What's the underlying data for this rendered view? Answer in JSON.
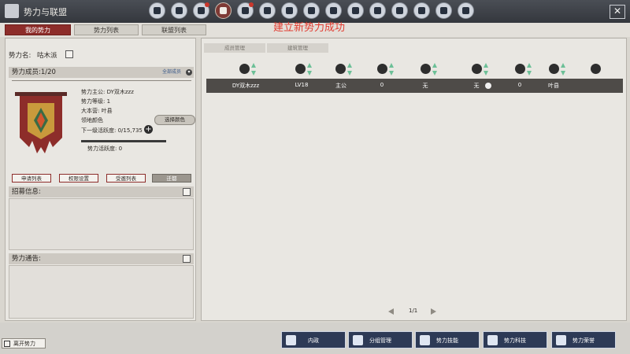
{
  "window": {
    "title": "势力与联盟",
    "close": "✕"
  },
  "top_icons": [
    "icon-1",
    "icon-2",
    "icon-3",
    "faction-icon",
    "icon-5",
    "icon-6",
    "icon-7",
    "icon-8",
    "icon-9",
    "icon-10",
    "icon-11",
    "icon-12",
    "icon-13",
    "icon-14",
    "icon-15"
  ],
  "tabs": {
    "my": "我的势力",
    "list": "势力列表",
    "alliance": "联盟列表"
  },
  "notice": "建立新势力成功",
  "left": {
    "faction_name_label": "势力名:",
    "faction_name": "咕木派",
    "members_label": "势力成员:1/20",
    "select_label": "全部成员",
    "info": {
      "lord": "势力主公: DY双木zzz",
      "level": "势力等级: 1",
      "base": "大本营: 叶县",
      "territory_color": "领地颜色",
      "next_activity": "下一级活跃度: 0/15,735",
      "activity": "势力活跃度: 0"
    },
    "choose_button": "选择颜色",
    "activity_progress": 0,
    "buttons": {
      "apply_list": "申请列表",
      "permissions": "权限设置",
      "invite_list": "受邀列表",
      "other": "迁都"
    },
    "recruit_label": "招募信息:",
    "announcement_label": "势力通告:"
  },
  "right": {
    "subtabs": {
      "members": "成员管理",
      "buildings": "建筑管理"
    },
    "row": {
      "name": "DY双木zzz",
      "level": "LV18",
      "role": "主公",
      "c4": "0",
      "c5": "无",
      "c6": "无",
      "c7": "0",
      "c8": "叶县"
    },
    "pager": "1/1"
  },
  "bottom": {
    "leave": "离开势力",
    "buttons": [
      "内政",
      "分组管理",
      "势力技能",
      "势力科技",
      "势力荣誉"
    ]
  },
  "colors": {
    "accent_red": "#8d2d2a",
    "notice_red": "#e23a2f",
    "bottom_blue": "#2d3a56",
    "sort_green": "#6cc097"
  }
}
